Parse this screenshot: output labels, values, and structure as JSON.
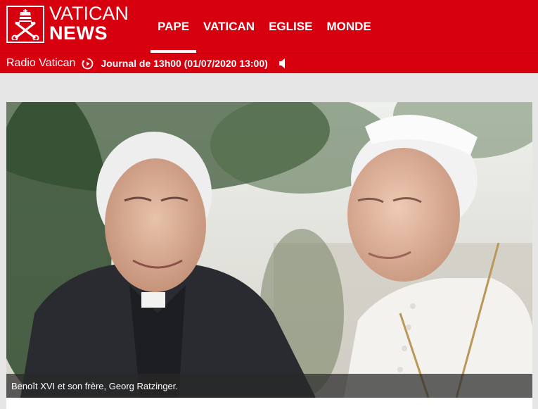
{
  "brand": {
    "line1": "VATICAN",
    "line2": "NEWS",
    "accent": "#d7000f"
  },
  "nav": {
    "items": [
      {
        "label": "PAPE",
        "active": true
      },
      {
        "label": "VATICAN",
        "active": false
      },
      {
        "label": "EGLISE",
        "active": false
      },
      {
        "label": "MONDE",
        "active": false
      }
    ]
  },
  "radio": {
    "label": "Radio Vatican",
    "play_icon": "play-circle-icon",
    "journal": "Journal de 13h00 (01/07/2020 13:00)",
    "speaker_icon": "speaker-icon"
  },
  "photo": {
    "caption": "Benoît XVI et son frère, Georg Ratzinger."
  }
}
